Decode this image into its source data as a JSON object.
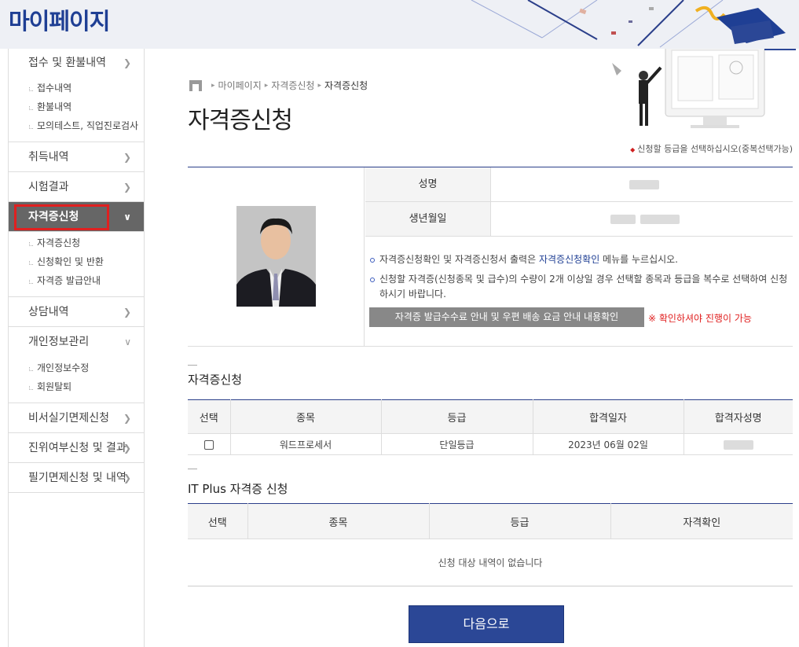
{
  "header": {
    "title": "마이페이지"
  },
  "sidebar": {
    "groups": [
      {
        "label": "접수 및 환불내역",
        "subitems": [
          "접수내역",
          "환불내역",
          "모의테스트, 직업진로검사"
        ]
      },
      {
        "label": "취득내역"
      },
      {
        "label": "시험결과"
      },
      {
        "label": "자격증신청",
        "subitems": [
          "자격증신청",
          "신청확인 및 반환",
          "자격증 발급안내"
        ]
      },
      {
        "label": "상담내역"
      },
      {
        "label": "개인정보관리",
        "subitems": [
          "개인정보수정",
          "회원탈퇴"
        ]
      },
      {
        "label": "비서실기면제신청"
      },
      {
        "label": "진위여부신청 및 결과"
      },
      {
        "label": "필기면제신청 및 내역"
      }
    ]
  },
  "breadcrumb": {
    "items": [
      "마이페이지",
      "자격증신청",
      "자격증신청"
    ]
  },
  "main": {
    "title": "자격증신청",
    "notice": "신청할 등급을 선택하십시오(중복선택가능)",
    "profile": {
      "name_label": "성명",
      "birth_label": "생년월일"
    },
    "notes": {
      "note1_pre": "자격증신청확인 및 자격증신청서 출력은 ",
      "note1_link": "자격증신청확인",
      "note1_post": " 메뉴를 누르십시오.",
      "note2": "신청할 자격증(신청종목 및 급수)의 수량이 2개 이상일 경우 선택할 종목과 등급을 복수로 선택하여 신청하시기 바랍니다."
    },
    "fee_button": "자격증 발급수수료 안내 및 우편 배송 요금 안내 내용확인",
    "fee_warning": "※ 확인하셔야 진행이 가능",
    "section1": {
      "title": "자격증신청",
      "headers": [
        "선택",
        "종목",
        "등급",
        "합격일자",
        "합격자성명"
      ],
      "rows": [
        {
          "subject": "워드프로세서",
          "grade": "단일등급",
          "pass_date": "2023년 06월 02일"
        }
      ]
    },
    "section2": {
      "title": "IT Plus 자격증 신청",
      "headers": [
        "선택",
        "종목",
        "등급",
        "자격확인"
      ],
      "empty": "신청 대상 내역이 없습니다"
    },
    "next_button": "다음으로"
  },
  "colors": {
    "brand": "#1f3f94",
    "button": "#2b4796",
    "warning": "#e02020",
    "active_menu": "#666666"
  }
}
